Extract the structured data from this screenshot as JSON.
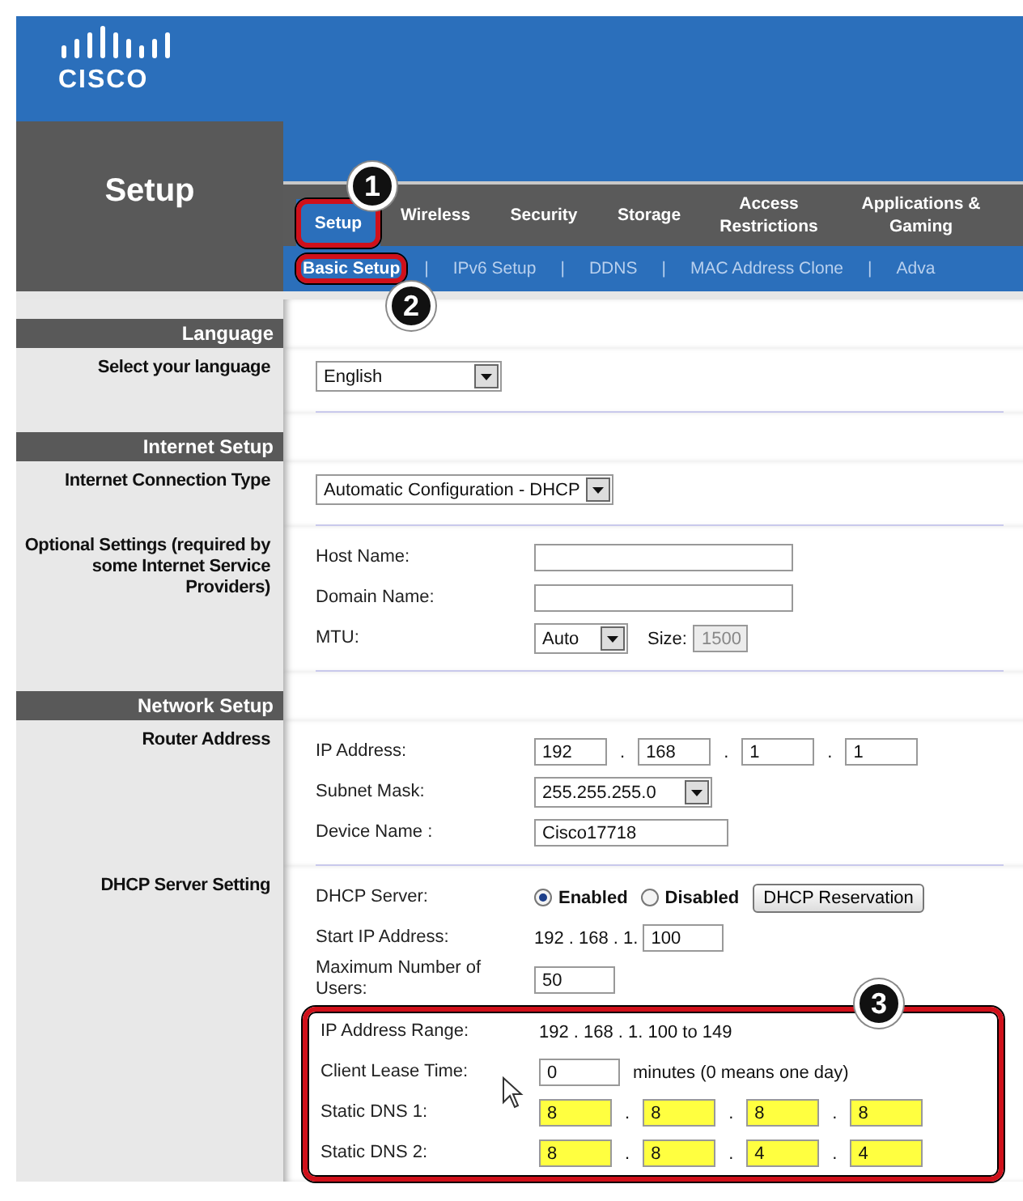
{
  "logo": "CISCO",
  "page_title": "Setup",
  "tabs": [
    {
      "label": "Setup",
      "selected": true,
      "callout": "1"
    },
    {
      "label": "Wireless",
      "selected": false
    },
    {
      "label": "Security",
      "selected": false
    },
    {
      "label": "Storage",
      "selected": false
    },
    {
      "label": "Access Restrictions",
      "selected": false
    },
    {
      "label": "Applications & Gaming",
      "selected": false
    }
  ],
  "subtabs": [
    {
      "label": "Basic Setup",
      "selected": true,
      "callout": "2"
    },
    {
      "label": "IPv6 Setup",
      "selected": false
    },
    {
      "label": "DDNS",
      "selected": false
    },
    {
      "label": "MAC Address Clone",
      "selected": false
    },
    {
      "label": "Adva",
      "selected": false
    }
  ],
  "subtab_separator": "|",
  "sections": [
    {
      "heading": "Language",
      "groups": [
        {
          "label": "Select your language",
          "rows": [
            {
              "kind": "select",
              "value": "English"
            }
          ]
        }
      ]
    },
    {
      "heading": "Internet Setup",
      "groups": [
        {
          "label": "Internet Connection Type",
          "rows": [
            {
              "kind": "select",
              "value": "Automatic Configuration - DHCP"
            }
          ]
        },
        {
          "label": "Optional Settings (required by some Internet Service Providers)",
          "rows": [
            {
              "kind": "field",
              "label": "Host Name:"
            },
            {
              "kind": "field",
              "label": "Domain Name:"
            },
            {
              "kind": "mtu",
              "label": "MTU:",
              "value": "Auto",
              "size_label": "Size:",
              "size_value": "1500"
            }
          ]
        }
      ]
    },
    {
      "heading": "Network Setup",
      "groups": [
        {
          "label": "Router Address",
          "rows": [
            {
              "kind": "ip",
              "label": "IP Address:",
              "parts": [
                "192",
                "168",
                "1",
                "1"
              ],
              "separator": ".",
              "highlighted": false
            },
            {
              "kind": "select",
              "label": "Subnet Mask:",
              "value": "255.255.255.0"
            },
            {
              "kind": "field",
              "label": "Device Name :",
              "value": "Cisco17718"
            }
          ]
        },
        {
          "label": "DHCP Server Setting",
          "rows": [
            {
              "kind": "radio",
              "label": "DHCP Server:",
              "options": [
                {
                  "label": "Enabled",
                  "selected": true
                },
                {
                  "label": "Disabled",
                  "selected": false
                }
              ],
              "button": "DHCP Reservation"
            },
            {
              "kind": "prefixed",
              "label": "Start IP Address:",
              "prefix": "192 . 168 . 1.",
              "value": "100"
            },
            {
              "kind": "field",
              "label": "Maximum Number of Users:",
              "value": "50"
            }
          ],
          "highlight": {
            "callout": "3",
            "rows": [
              {
                "kind": "text",
                "label": "IP Address Range:",
                "value": "192 . 168 . 1. 100 to 149"
              },
              {
                "kind": "field",
                "label": "Client Lease Time:",
                "value": "0",
                "suffix": "minutes (0 means one day)"
              },
              {
                "kind": "ip",
                "label": "Static DNS 1:",
                "parts": [
                  "8",
                  "8",
                  "8",
                  "8"
                ],
                "separator": ".",
                "highlighted": true
              },
              {
                "kind": "ip",
                "label": "Static DNS 2:",
                "parts": [
                  "8",
                  "8",
                  "4",
                  "4"
                ],
                "separator": ".",
                "highlighted": true
              }
            ]
          }
        }
      ]
    }
  ]
}
